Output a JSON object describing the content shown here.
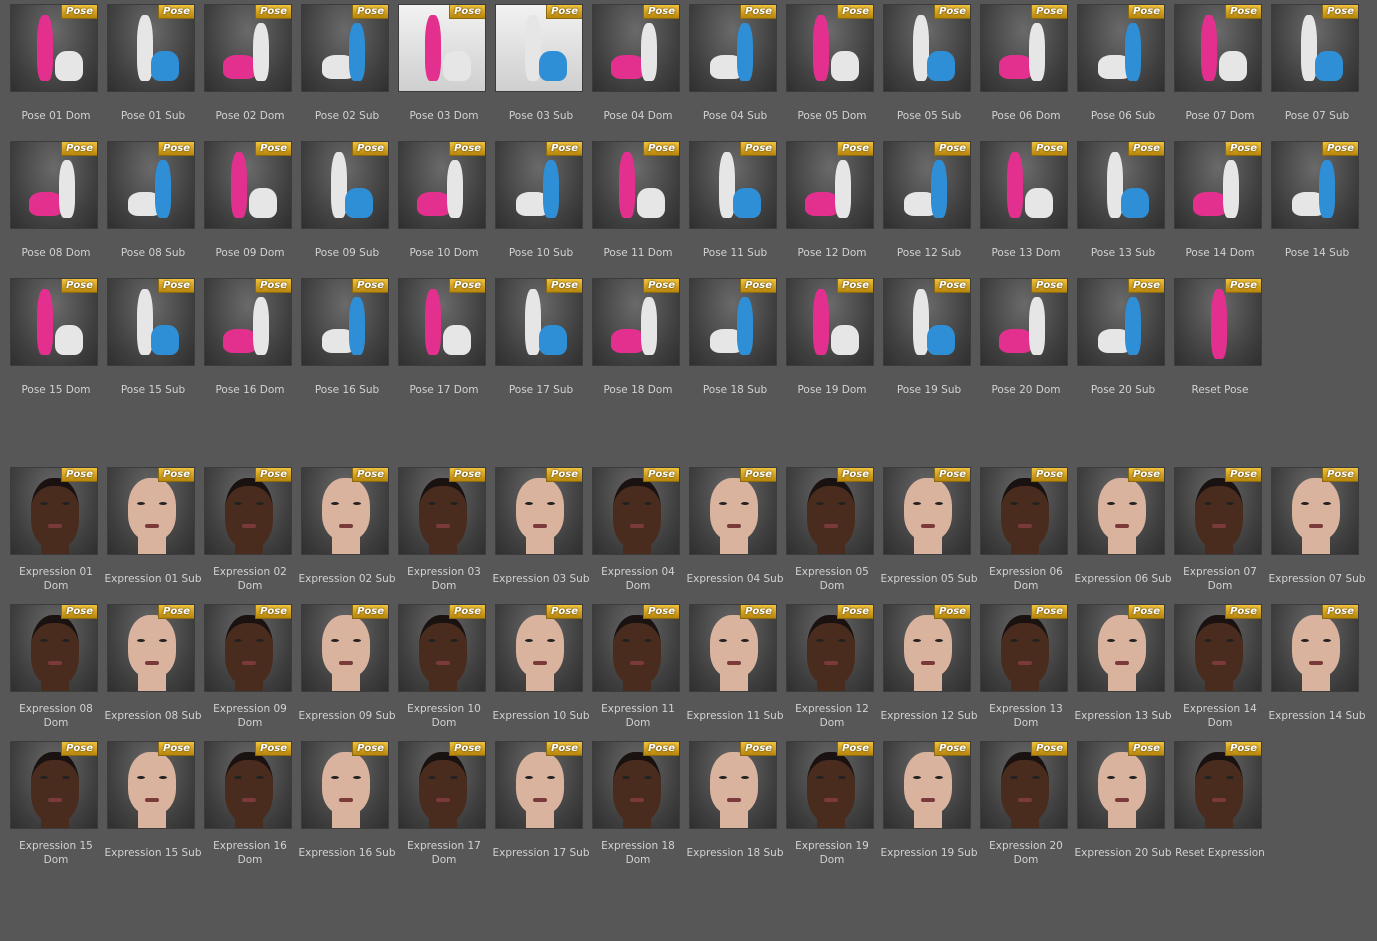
{
  "badge_text": "Pose",
  "colors": {
    "background": "#575757",
    "dom_pink": "#e3308e",
    "sub_blue": "#2f8fd6",
    "neutral_white": "#e6e6e6",
    "dark_skin": "#4a2c1e",
    "light_skin": "#d9b39e"
  },
  "poses": [
    {
      "label": "Pose 01 Dom",
      "role": "dom"
    },
    {
      "label": "Pose 01 Sub",
      "role": "sub"
    },
    {
      "label": "Pose 02 Dom",
      "role": "dom"
    },
    {
      "label": "Pose 02 Sub",
      "role": "sub"
    },
    {
      "label": "Pose 03 Dom",
      "role": "dom",
      "bright": true
    },
    {
      "label": "Pose 03 Sub",
      "role": "sub",
      "bright": true
    },
    {
      "label": "Pose 04 Dom",
      "role": "dom"
    },
    {
      "label": "Pose 04 Sub",
      "role": "sub"
    },
    {
      "label": "Pose 05 Dom",
      "role": "dom"
    },
    {
      "label": "Pose 05 Sub",
      "role": "sub"
    },
    {
      "label": "Pose 06 Dom",
      "role": "dom"
    },
    {
      "label": "Pose 06 Sub",
      "role": "sub"
    },
    {
      "label": "Pose 07 Dom",
      "role": "dom"
    },
    {
      "label": "Pose 07 Sub",
      "role": "sub"
    },
    {
      "label": "Pose 08 Dom",
      "role": "dom"
    },
    {
      "label": "Pose 08 Sub",
      "role": "sub"
    },
    {
      "label": "Pose 09 Dom",
      "role": "dom"
    },
    {
      "label": "Pose 09 Sub",
      "role": "sub"
    },
    {
      "label": "Pose 10 Dom",
      "role": "dom"
    },
    {
      "label": "Pose 10 Sub",
      "role": "sub"
    },
    {
      "label": "Pose 11 Dom",
      "role": "dom"
    },
    {
      "label": "Pose 11 Sub",
      "role": "sub"
    },
    {
      "label": "Pose 12 Dom",
      "role": "dom"
    },
    {
      "label": "Pose 12 Sub",
      "role": "sub"
    },
    {
      "label": "Pose 13 Dom",
      "role": "dom"
    },
    {
      "label": "Pose 13 Sub",
      "role": "sub"
    },
    {
      "label": "Pose 14 Dom",
      "role": "dom"
    },
    {
      "label": "Pose 14 Sub",
      "role": "sub"
    },
    {
      "label": "Pose 15 Dom",
      "role": "dom"
    },
    {
      "label": "Pose 15 Sub",
      "role": "sub"
    },
    {
      "label": "Pose 16 Dom",
      "role": "dom"
    },
    {
      "label": "Pose 16 Sub",
      "role": "sub"
    },
    {
      "label": "Pose 17 Dom",
      "role": "dom"
    },
    {
      "label": "Pose 17 Sub",
      "role": "sub"
    },
    {
      "label": "Pose 18 Dom",
      "role": "dom"
    },
    {
      "label": "Pose 18 Sub",
      "role": "sub"
    },
    {
      "label": "Pose 19 Dom",
      "role": "dom"
    },
    {
      "label": "Pose 19 Sub",
      "role": "sub"
    },
    {
      "label": "Pose 20 Dom",
      "role": "dom"
    },
    {
      "label": "Pose 20 Sub",
      "role": "sub"
    },
    {
      "label": "Reset Pose",
      "role": "reset"
    }
  ],
  "expressions": [
    {
      "label": "Expression 01 Dom",
      "role": "dom"
    },
    {
      "label": "Expression 01 Sub",
      "role": "sub"
    },
    {
      "label": "Expression 02 Dom",
      "role": "dom"
    },
    {
      "label": "Expression 02 Sub",
      "role": "sub"
    },
    {
      "label": "Expression 03 Dom",
      "role": "dom"
    },
    {
      "label": "Expression 03 Sub",
      "role": "sub"
    },
    {
      "label": "Expression 04 Dom",
      "role": "dom"
    },
    {
      "label": "Expression 04 Sub",
      "role": "sub"
    },
    {
      "label": "Expression 05 Dom",
      "role": "dom"
    },
    {
      "label": "Expression 05 Sub",
      "role": "sub"
    },
    {
      "label": "Expression 06 Dom",
      "role": "dom"
    },
    {
      "label": "Expression 06 Sub",
      "role": "sub"
    },
    {
      "label": "Expression 07 Dom",
      "role": "dom"
    },
    {
      "label": "Expression 07 Sub",
      "role": "sub"
    },
    {
      "label": "Expression 08 Dom",
      "role": "dom"
    },
    {
      "label": "Expression 08 Sub",
      "role": "sub"
    },
    {
      "label": "Expression 09 Dom",
      "role": "dom"
    },
    {
      "label": "Expression 09 Sub",
      "role": "sub"
    },
    {
      "label": "Expression 10 Dom",
      "role": "dom"
    },
    {
      "label": "Expression 10 Sub",
      "role": "sub"
    },
    {
      "label": "Expression 11 Dom",
      "role": "dom"
    },
    {
      "label": "Expression 11 Sub",
      "role": "sub"
    },
    {
      "label": "Expression 12 Dom",
      "role": "dom"
    },
    {
      "label": "Expression 12 Sub",
      "role": "sub"
    },
    {
      "label": "Expression 13 Dom",
      "role": "dom"
    },
    {
      "label": "Expression 13 Sub",
      "role": "sub"
    },
    {
      "label": "Expression 14 Dom",
      "role": "dom"
    },
    {
      "label": "Expression 14 Sub",
      "role": "sub"
    },
    {
      "label": "Expression 15 Dom",
      "role": "dom"
    },
    {
      "label": "Expression 15 Sub",
      "role": "sub"
    },
    {
      "label": "Expression 16 Dom",
      "role": "dom"
    },
    {
      "label": "Expression 16 Sub",
      "role": "sub"
    },
    {
      "label": "Expression 17 Dom",
      "role": "dom"
    },
    {
      "label": "Expression 17 Sub",
      "role": "sub"
    },
    {
      "label": "Expression 18 Dom",
      "role": "dom"
    },
    {
      "label": "Expression 18 Sub",
      "role": "sub"
    },
    {
      "label": "Expression 19 Dom",
      "role": "dom"
    },
    {
      "label": "Expression 19 Sub",
      "role": "sub"
    },
    {
      "label": "Expression 20 Dom",
      "role": "dom"
    },
    {
      "label": "Expression 20 Sub",
      "role": "sub"
    },
    {
      "label": "Reset Expression",
      "role": "reset"
    }
  ]
}
